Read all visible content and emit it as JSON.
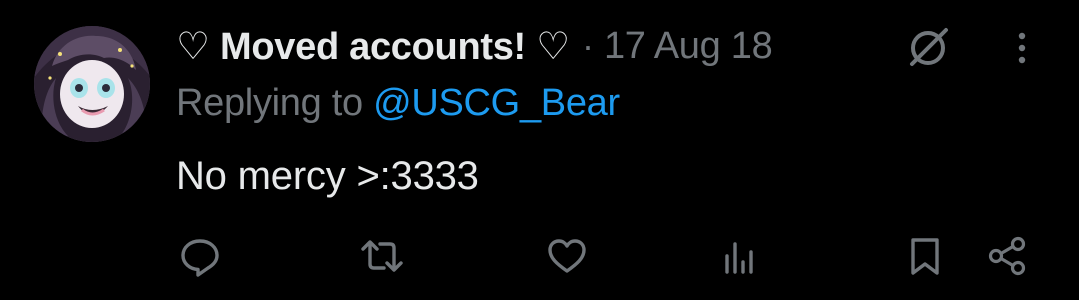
{
  "tweet": {
    "display_name": "♡ Moved accounts! ♡",
    "separator": "·",
    "timestamp": "17 Aug 18",
    "replying_prefix": "Replying to ",
    "replying_handle": "@USCG_Bear",
    "text": "No mercy >:3333"
  },
  "icons": {
    "header": [
      "grok-icon",
      "more-options-icon"
    ],
    "actions": [
      "reply-icon",
      "retweet-icon",
      "like-icon",
      "views-icon",
      "bookmark-icon",
      "share-icon"
    ]
  },
  "colors": {
    "background": "#000000",
    "text_primary": "#e7e9ea",
    "text_secondary": "#71767b",
    "link": "#1d9bf0"
  }
}
